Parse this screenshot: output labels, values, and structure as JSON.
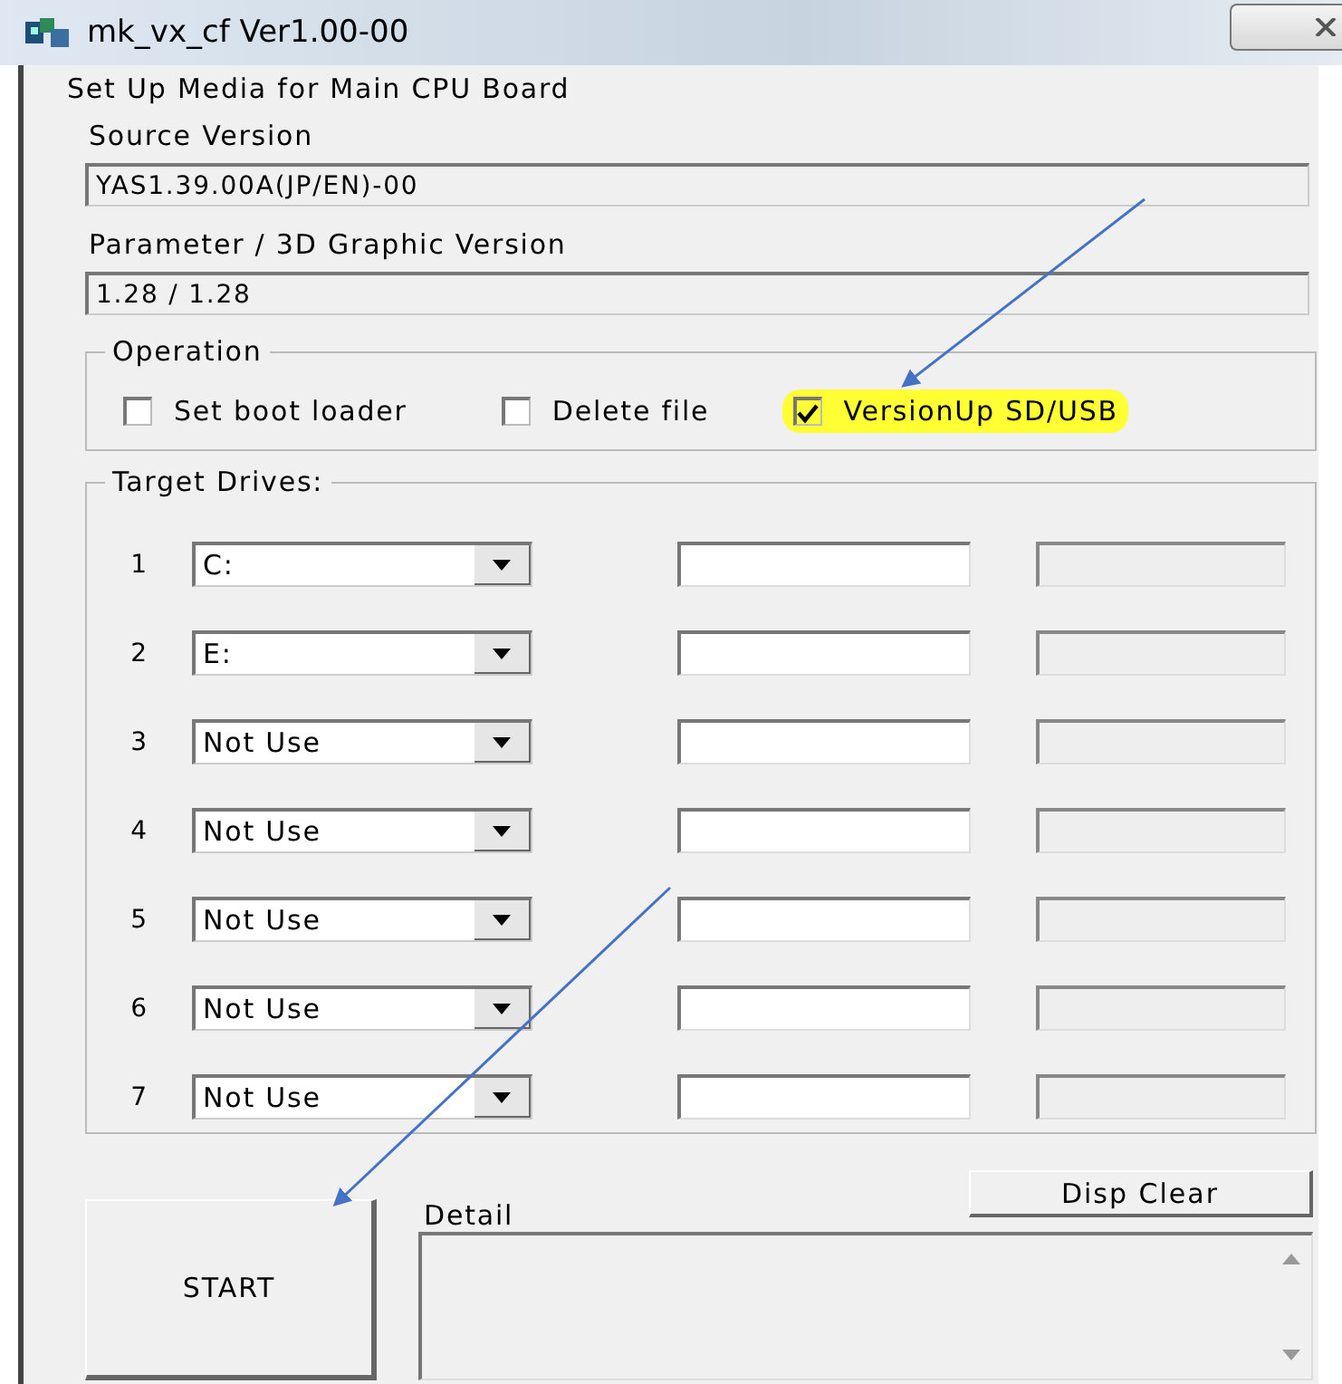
{
  "window": {
    "title": "mk_vx_cf Ver1.00-00"
  },
  "heading": "Set Up Media for Main CPU Board",
  "source_version": {
    "label": "Source Version",
    "value": "YAS1.39.00A(JP/EN)-00"
  },
  "parameter_version": {
    "label": "Parameter / 3D Graphic Version",
    "value": "1.28 / 1.28"
  },
  "operation": {
    "title": "Operation",
    "options": [
      {
        "label": "Set boot loader",
        "checked": false,
        "highlighted": false
      },
      {
        "label": "Delete file",
        "checked": false,
        "highlighted": false
      },
      {
        "label": "VersionUp SD/USB",
        "checked": true,
        "highlighted": true
      }
    ]
  },
  "target_drives": {
    "title": "Target Drives:",
    "rows": [
      {
        "number": "1",
        "drive": "C:"
      },
      {
        "number": "2",
        "drive": "E:"
      },
      {
        "number": "3",
        "drive": "Not Use"
      },
      {
        "number": "4",
        "drive": "Not Use"
      },
      {
        "number": "5",
        "drive": "Not Use"
      },
      {
        "number": "6",
        "drive": "Not Use"
      },
      {
        "number": "7",
        "drive": "Not Use"
      }
    ]
  },
  "buttons": {
    "start": "START",
    "disp_clear": "Disp Clear"
  },
  "detail": {
    "label": "Detail"
  }
}
